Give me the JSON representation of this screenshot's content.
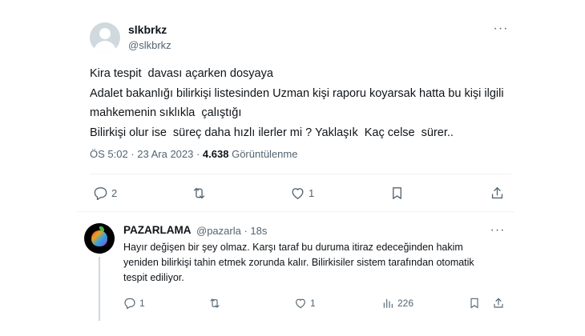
{
  "tweet": {
    "author_name": "slkbrkz",
    "author_handle": "@slkbrkz",
    "more_glyph": "···",
    "text": "Kira tespit  davası açarken dosyaya\nAdalet bakanlığı bilirkişi listesinden Uzman kişi raporu koyarsak hatta bu kişi ilgili mahkemenin sıklıkla  çalıştığı\nBilirkişi olur ise  süreç daha hızlı ilerler mi ? Yaklaşık  Kaç celse  sürer..",
    "timestamp": "ÖS 5:02 · 23 Ara 2023 · ",
    "views_count": "4.638",
    "views_label": " Görüntülenme",
    "actions": {
      "reply_count": "2",
      "retweet_count": "",
      "like_count": "1"
    },
    "icons": [
      "reply-icon",
      "retweet-icon",
      "like-icon",
      "bookmark-icon",
      "share-icon"
    ]
  },
  "reply": {
    "author_name": "PAZARLAMA",
    "author_meta": "@pazarla · 18s",
    "more_glyph": "···",
    "text": "Hayır değişen bir şey olmaz. Karşı taraf bu duruma itiraz edeceğinden hakim yeniden bilirkişi tahin etmek zorunda kalır. Bilirkisiler sistem tarafından otomatik tespit ediliyor.",
    "actions": {
      "reply_count": "1",
      "retweet_count": "",
      "like_count": "1",
      "views_count": "226"
    },
    "icons": [
      "reply-icon",
      "retweet-icon",
      "like-icon",
      "views-icon",
      "bookmark-icon",
      "share-icon"
    ]
  },
  "colors": {
    "text_primary": "#0f1419",
    "text_secondary": "#536471",
    "divider": "#eff3f4"
  }
}
